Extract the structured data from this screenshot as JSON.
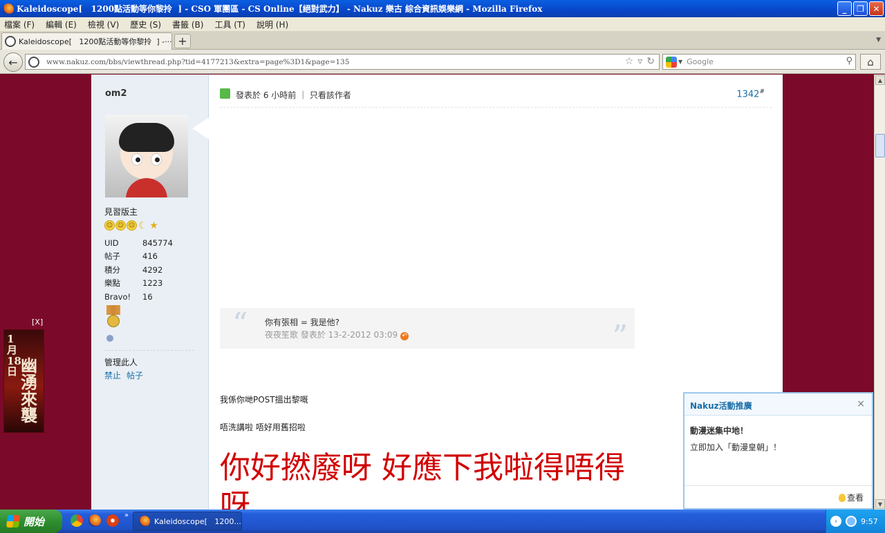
{
  "window": {
    "title": "Kaleidoscope[   1200點活動等你黎拎  ] - CSO 軍團區 - CS Online【絕對武力】 - Nakuz 樂古 綜合資訊娛樂網 - Mozilla Firefox"
  },
  "menu": [
    "檔案 (F)",
    "編輯 (E)",
    "檢視 (V)",
    "歷史 (S)",
    "書籤 (B)",
    "工具 (T)",
    "說明 (H)"
  ],
  "tab": {
    "label": "Kaleidoscope[   1200點活動等你黎拎  ] -···"
  },
  "nav": {
    "url": "www.nakuz.com/bbs/viewthread.php?tid=4177213&extra=page%3D1&page=135",
    "search_placeholder": "Google"
  },
  "profile": {
    "username": "om2",
    "rank": "見習版主",
    "stats": [
      {
        "key": "UID",
        "value": "845774"
      },
      {
        "key": "帖子",
        "value": "416"
      },
      {
        "key": "積分",
        "value": "4292"
      },
      {
        "key": "樂點",
        "value": "1223"
      },
      {
        "key": "Bravo!",
        "value": "16"
      }
    ],
    "manage_label": "管理此人",
    "manage_links": [
      "禁止",
      "帖子"
    ]
  },
  "post": {
    "meta": "發表於 6 小時前 ｜ 只看該作者",
    "number": "1342",
    "number_sup": "#",
    "quote_text": "你有張相 = 我是他?",
    "quote_source": "夜夜笙歌 發表於 13-2-2012 03:09",
    "line1": "我係你哋POST搵出黎嘅",
    "line2": "唔洗講啦 唔好用舊招啦",
    "big_text": "你好撚廢呀 好應下我啦得唔得呀"
  },
  "left_ad": {
    "close": "[X]",
    "date": "1月18日",
    "title": "幽湧來襲"
  },
  "popup": {
    "title": "Nakuz活動推廣",
    "close": "×",
    "subtitle": "動漫迷集中地！",
    "body": "立即加入「動漫皇朝」！",
    "view_label": "查看"
  },
  "taskbar": {
    "start": "開始",
    "task": "Kaleidoscope[   1200...",
    "time": "9:57"
  }
}
